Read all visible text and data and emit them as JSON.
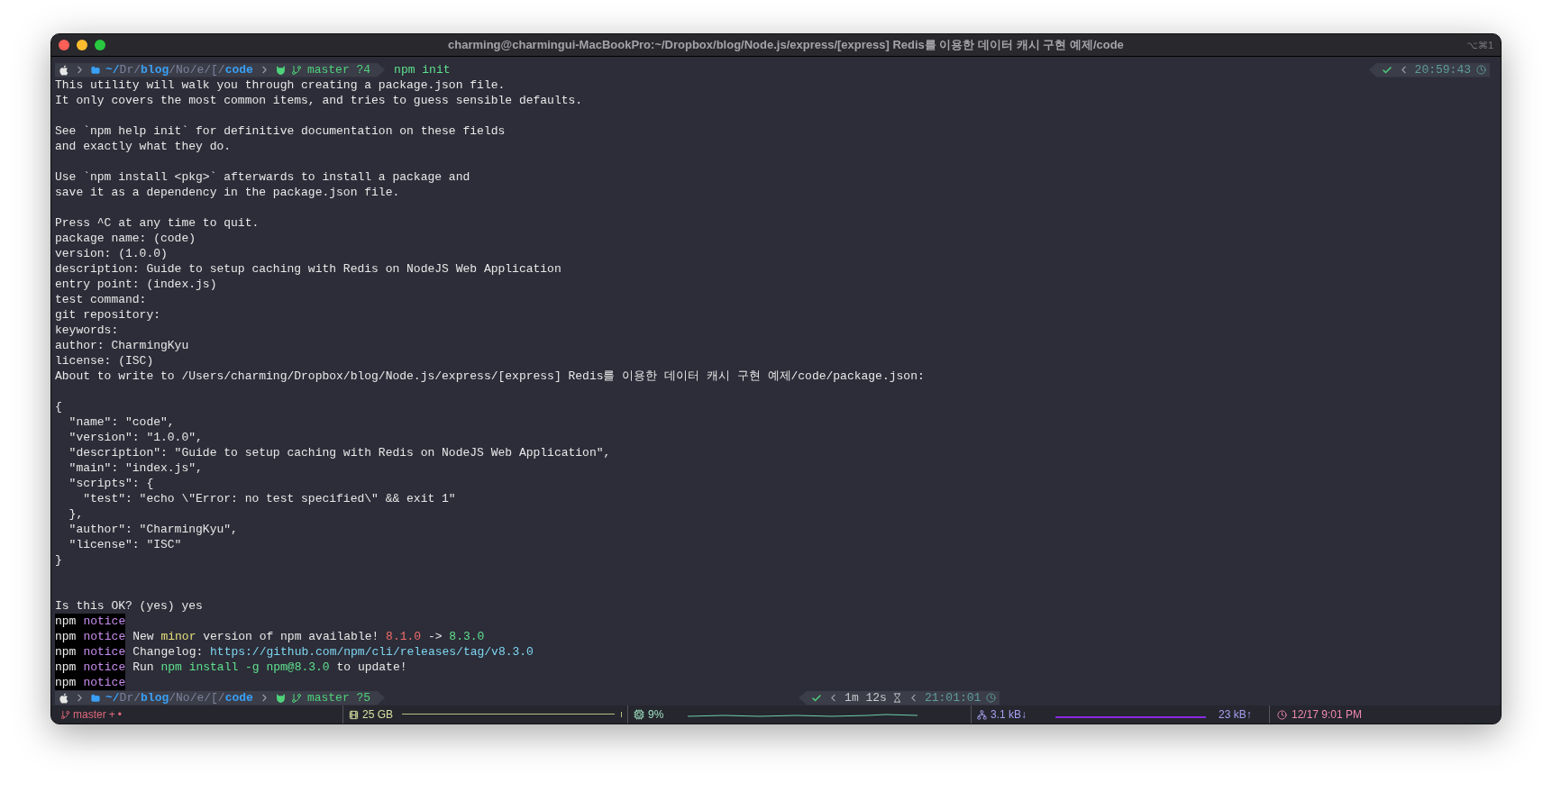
{
  "window": {
    "title": "charming@charmingui-MacBookPro:~/Dropbox/blog/Node.js/express/[express] Redis를 이용한 데이터 캐시 구현 예제/code",
    "shortcut": "⌥⌘1"
  },
  "top_prompt": {
    "path": [
      {
        "text": "~/",
        "kind": "home"
      },
      {
        "text": "Dr",
        "kind": "dim"
      },
      {
        "text": "/",
        "kind": "dim"
      },
      {
        "text": "blog",
        "kind": "bold"
      },
      {
        "text": "/No/e/[/",
        "kind": "dim"
      },
      {
        "text": "code",
        "kind": "bold"
      }
    ],
    "git": "master ?4",
    "command": "npm init",
    "time": "20:59:43"
  },
  "output": [
    {
      "kind": "text",
      "text": "This utility will walk you through creating a package.json file."
    },
    {
      "kind": "text",
      "text": "It only covers the most common items, and tries to guess sensible defaults."
    },
    {
      "kind": "blank"
    },
    {
      "kind": "text",
      "text": "See `npm help init` for definitive documentation on these fields"
    },
    {
      "kind": "text",
      "text": "and exactly what they do."
    },
    {
      "kind": "blank"
    },
    {
      "kind": "text",
      "text": "Use `npm install <pkg>` afterwards to install a package and"
    },
    {
      "kind": "text",
      "text": "save it as a dependency in the package.json file."
    },
    {
      "kind": "blank"
    },
    {
      "kind": "text",
      "text": "Press ^C at any time to quit."
    },
    {
      "kind": "text",
      "text": "package name: (code)"
    },
    {
      "kind": "text",
      "text": "version: (1.0.0)"
    },
    {
      "kind": "text",
      "text": "description: Guide to setup caching with Redis on NodeJS Web Application"
    },
    {
      "kind": "text",
      "text": "entry point: (index.js)"
    },
    {
      "kind": "text",
      "text": "test command:"
    },
    {
      "kind": "text",
      "text": "git repository:"
    },
    {
      "kind": "text",
      "text": "keywords:"
    },
    {
      "kind": "text",
      "text": "author: CharmingKyu"
    },
    {
      "kind": "text",
      "text": "license: (ISC)"
    },
    {
      "kind": "text",
      "text": "About to write to /Users/charming/Dropbox/blog/Node.js/express/[express] Redis를 이용한 데이터 캐시 구현 예제/code/package.json:"
    },
    {
      "kind": "blank"
    },
    {
      "kind": "text",
      "text": "{"
    },
    {
      "kind": "text",
      "text": "  \"name\": \"code\","
    },
    {
      "kind": "text",
      "text": "  \"version\": \"1.0.0\","
    },
    {
      "kind": "text",
      "text": "  \"description\": \"Guide to setup caching with Redis on NodeJS Web Application\","
    },
    {
      "kind": "text",
      "text": "  \"main\": \"index.js\","
    },
    {
      "kind": "text",
      "text": "  \"scripts\": {"
    },
    {
      "kind": "text",
      "text": "    \"test\": \"echo \\\"Error: no test specified\\\" && exit 1\""
    },
    {
      "kind": "text",
      "text": "  },"
    },
    {
      "kind": "text",
      "text": "  \"author\": \"CharmingKyu\","
    },
    {
      "kind": "text",
      "text": "  \"license\": \"ISC\""
    },
    {
      "kind": "text",
      "text": "}"
    },
    {
      "kind": "blank"
    },
    {
      "kind": "blank"
    },
    {
      "kind": "text",
      "text": "Is this OK? (yes) yes"
    },
    {
      "kind": "notice",
      "prefix": "npm",
      "tag": "notice"
    },
    {
      "kind": "notice",
      "prefix": "npm",
      "tag": "notice",
      "parts": [
        {
          "text": "New ",
          "kind": "plain"
        },
        {
          "text": "minor",
          "kind": "highlight"
        },
        {
          "text": " version of npm available! ",
          "kind": "plain"
        },
        {
          "text": "8.1.0",
          "kind": "old"
        },
        {
          "text": " -> ",
          "kind": "plain"
        },
        {
          "text": "8.3.0",
          "kind": "new"
        }
      ]
    },
    {
      "kind": "notice",
      "prefix": "npm",
      "tag": "notice",
      "parts": [
        {
          "text": "Changelog: ",
          "kind": "plain"
        },
        {
          "text": "https://github.com/npm/cli/releases/tag/v8.3.0",
          "kind": "link"
        }
      ]
    },
    {
      "kind": "notice",
      "prefix": "npm",
      "tag": "notice",
      "parts": [
        {
          "text": "Run ",
          "kind": "plain"
        },
        {
          "text": "npm install -g npm@8.3.0",
          "kind": "new"
        },
        {
          "text": " to update!",
          "kind": "plain"
        }
      ]
    },
    {
      "kind": "notice",
      "prefix": "npm",
      "tag": "notice"
    }
  ],
  "bottom_prompt": {
    "path": [
      {
        "text": "~/",
        "kind": "home"
      },
      {
        "text": "Dr",
        "kind": "dim"
      },
      {
        "text": "/",
        "kind": "dim"
      },
      {
        "text": "blog",
        "kind": "bold"
      },
      {
        "text": "/No/e/[/",
        "kind": "dim"
      },
      {
        "text": "code",
        "kind": "bold"
      }
    ],
    "git": "master ?5",
    "duration": "1m 12s",
    "time": "21:01:01"
  },
  "status_bar": {
    "branch": "master",
    "branch_flags": [
      "+",
      "•"
    ],
    "disk": {
      "reading": "25 GB",
      "level": 0.97
    },
    "cpu": {
      "reading": "9%"
    },
    "network": {
      "down": "3.1 kB↓",
      "up": "23 kB↑"
    },
    "clock": "12/17 9:01 PM"
  }
}
